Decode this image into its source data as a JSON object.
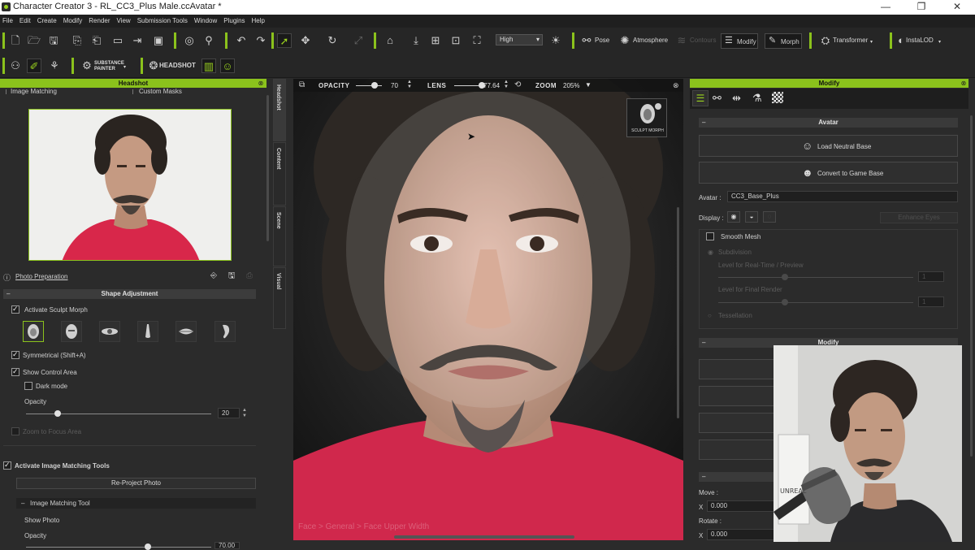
{
  "window": {
    "title": "Character Creator 3 - RL_CC3_Plus Male.ccAvatar *",
    "controls": [
      "—",
      "❐",
      "✕"
    ]
  },
  "menu": [
    "File",
    "Edit",
    "Create",
    "Modify",
    "Render",
    "View",
    "Submission Tools",
    "Window",
    "Plugins",
    "Help"
  ],
  "toolbar": {
    "quality": "High",
    "pose": "Pose",
    "atmosphere": "Atmosphere",
    "contours": "Contours",
    "modify": "Modify",
    "morph": "Morph",
    "transformer": "Transformer",
    "instalod": "InstaLOD",
    "substance": "SUBSTANCE",
    "substance_sub": "PAINTER",
    "headshot": "HEADSHOT"
  },
  "headshot_panel": {
    "header": "Headshot",
    "tab_image_matching": "Image Matching",
    "tab_custom_masks": "Custom Masks",
    "photo_preparation": "Photo Preparation",
    "shape_adjustment": "Shape Adjustment",
    "activate_sculpt_morph": "Activate Sculpt Morph",
    "symmetrical": "Symmetrical (Shift+A)",
    "show_control_area": "Show Control Area",
    "dark_mode": "Dark mode",
    "opacity_label": "Opacity",
    "opacity_value": "20",
    "zoom_to_focus": "Zoom to Focus Area",
    "activate_image_matching": "Activate Image Matching Tools",
    "reproject_photo": "Re-Project Photo",
    "image_matching_tool": "Image Matching Tool",
    "show_photo": "Show Photo",
    "opacity2_label": "Opacity",
    "opacity2_value": "70.00"
  },
  "side_tabs": [
    "Headshot",
    "Content",
    "Scene",
    "Visual"
  ],
  "viewport": {
    "opacity_label": "OPACITY",
    "opacity_value": "70",
    "lens_label": "LENS",
    "lens_value": "77.64",
    "zoom_label": "ZOOM",
    "zoom_value": "205%",
    "sculpt_morph_badge": "SCULPT MORPH",
    "breadcrumb": "Face > General > Face Upper Width"
  },
  "modify_panel": {
    "header": "Modify",
    "avatar_section": "Avatar",
    "load_neutral_base": "Load Neutral Base",
    "convert_to_game_base": "Convert to Game Base",
    "avatar_label": "Avatar :",
    "avatar_value": "CC3_Base_Plus",
    "display_label": "Display :",
    "enhance_eyes": "Enhance Eyes",
    "smooth_mesh": "Smooth Mesh",
    "subdivision": "Subdivision",
    "level_realtime": "Level for Real-Time / Preview",
    "level_realtime_value": "1",
    "level_final": "Level for Final Render",
    "level_final_value": "1",
    "tessellation": "Tessellation",
    "modify_section": "Modify",
    "move_label": "Move :",
    "move_x_axis": "X",
    "move_x_value": "0.000",
    "rotate_label": "Rotate :",
    "rotate_x_axis": "X",
    "rotate_x_value": "0.000"
  },
  "webcam": {
    "note_text": "UNREAL"
  },
  "colors": {
    "accent": "#8bc21c",
    "panel_bg": "#2b2b2b",
    "viewport_bg": "#1a1a1a"
  }
}
